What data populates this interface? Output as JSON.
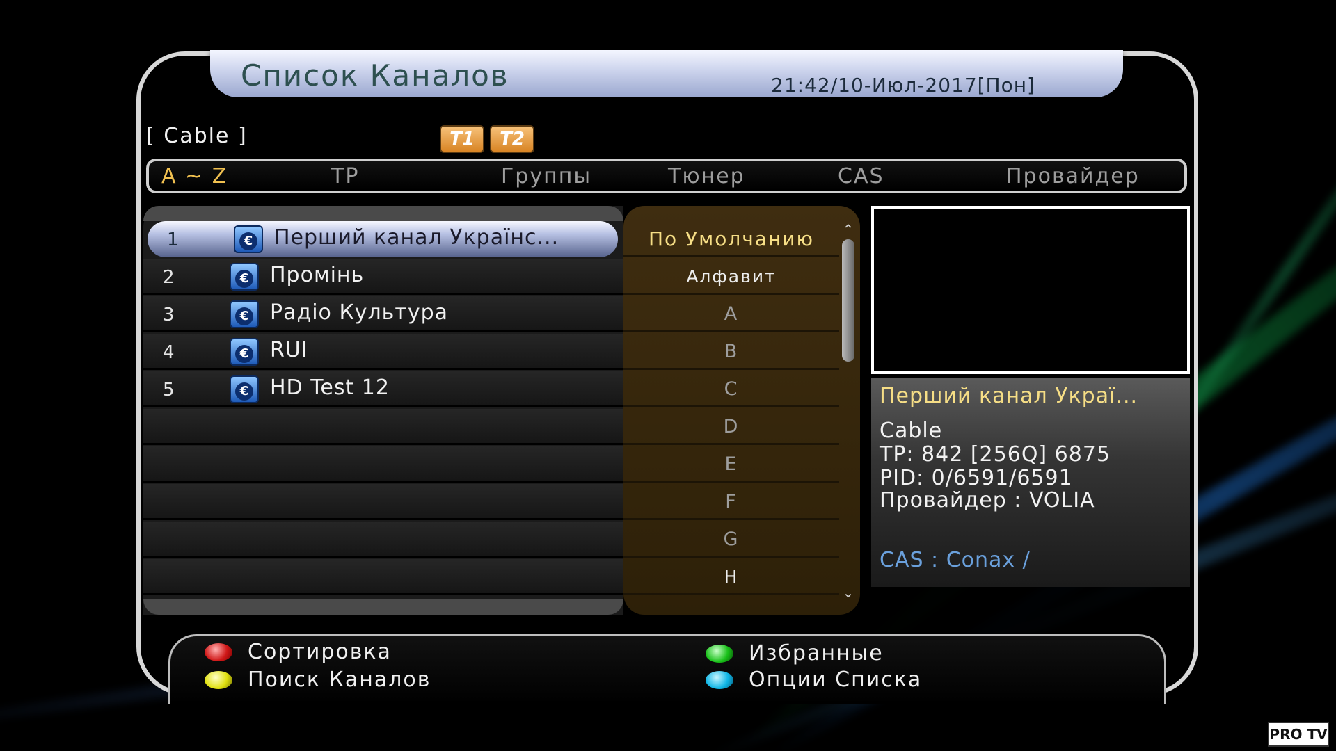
{
  "header": {
    "title": "Список Каналов",
    "datetime": "21:42/10-Июл-2017[Пон]"
  },
  "source_label": "[ Cable ]",
  "tuners": [
    "T1",
    "T2"
  ],
  "sort_tabs": [
    "A ~ Z",
    "TP",
    "Группы",
    "Тюнер",
    "CAS",
    "Провайдер"
  ],
  "active_sort_tab": "A ~ Z",
  "channels": [
    {
      "num": "1",
      "name": "Перший канал Українс...",
      "icon": "euro-cas-icon"
    },
    {
      "num": "2",
      "name": "Промінь",
      "icon": "euro-cas-icon"
    },
    {
      "num": "3",
      "name": "Радіо Культура",
      "icon": "euro-cas-icon"
    },
    {
      "num": "4",
      "name": "RUI",
      "icon": "euro-cas-icon"
    },
    {
      "num": "5",
      "name": "HD Test 12",
      "icon": "euro-cas-icon"
    }
  ],
  "cas_icon_glyph": "€",
  "sort_options": [
    "По Умолчанию",
    "Алфавит",
    "A",
    "B",
    "C",
    "D",
    "E",
    "F",
    "G",
    "H"
  ],
  "selected_sort_option": "По Умолчанию",
  "channel_info": {
    "name": "Перший канал Украї...",
    "source": "Cable",
    "tp": "TP: 842 [256Q] 6875",
    "pid": "PID: 0/6591/6591",
    "provider": "Провайдер : VOLIA",
    "cas": "CAS : Conax /"
  },
  "footer": {
    "red": "Сортировка",
    "green": "Избранные",
    "yellow": "Поиск Каналов",
    "blue": "Опции Списка"
  },
  "watermark": "PRO TV",
  "colors": {
    "accent_gold": "#f6de86",
    "cas_blue": "#6aa0dc",
    "active_tab": "#f0c050"
  }
}
